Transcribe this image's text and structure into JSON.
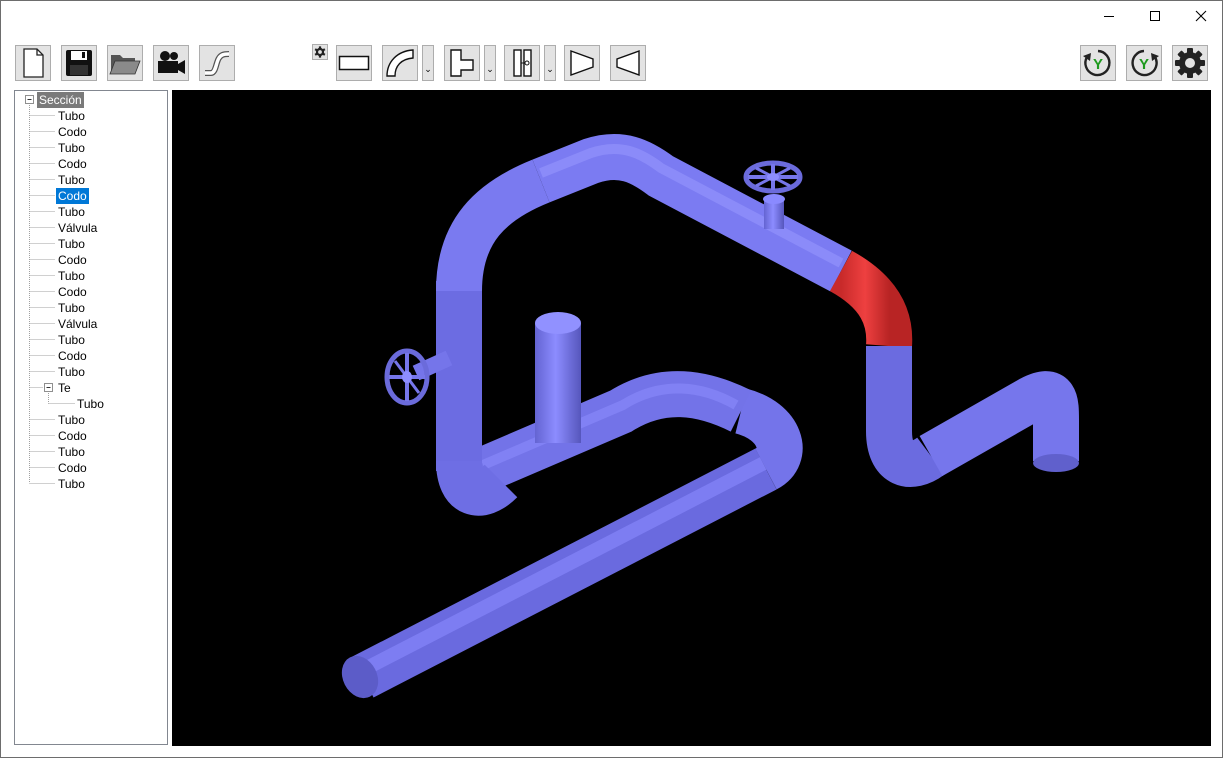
{
  "window": {
    "controls": [
      "minimize-icon",
      "maximize-icon",
      "close-icon"
    ]
  },
  "toolbar": {
    "left_icons": [
      "new-file-icon",
      "save-icon",
      "open-folder-icon",
      "camera-icon",
      "pipe-route-icon"
    ],
    "small_settings_icon": "small-gear-icon",
    "component_icons": [
      "straight-tube-icon",
      "elbow-icon",
      "tee-icon",
      "valve-component-icon",
      "reducer-icon",
      "expander-icon"
    ],
    "right_icons": [
      "rotate-y-clockwise-icon",
      "rotate-y-counterclockwise-icon",
      "settings-gear-icon"
    ],
    "axis_label": "Y",
    "dropdown_glyph": "⌄"
  },
  "tree": {
    "root": "Sección",
    "items": [
      "Tubo",
      "Codo",
      "Tubo",
      "Codo",
      "Tubo",
      "Codo",
      "Tubo",
      "Válvula",
      "Tubo",
      "Codo",
      "Tubo",
      "Codo",
      "Tubo",
      "Válvula",
      "Tubo",
      "Codo",
      "Tubo"
    ],
    "group": "Te",
    "group_child": "Tubo",
    "tail_items": [
      "Tubo",
      "Codo",
      "Tubo",
      "Codo",
      "Tubo"
    ],
    "selected_index": 5
  },
  "viewport": {
    "background": "#000000",
    "pipe_color": "#7f7ff2",
    "highlight_color": "#e23434"
  }
}
